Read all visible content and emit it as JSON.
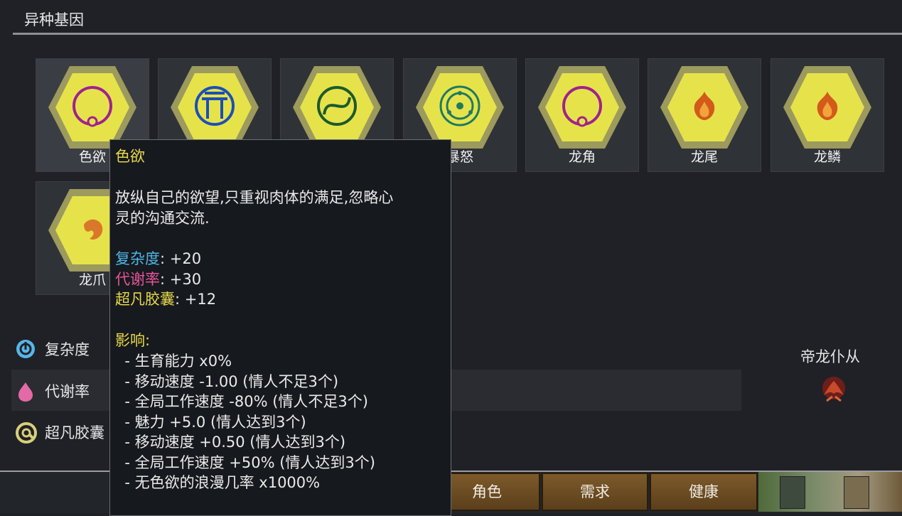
{
  "section_title": "异种基因",
  "genes": [
    {
      "label": "色欲",
      "icon": "lust-ring-icon"
    },
    {
      "label": "",
      "icon": "pi-circle-icon"
    },
    {
      "label": "",
      "icon": "swirl-circle-icon"
    },
    {
      "label": "暴怒",
      "icon": "triskele-circle-icon"
    },
    {
      "label": "龙角",
      "icon": "ring-icon"
    },
    {
      "label": "龙尾",
      "icon": "flame-icon"
    },
    {
      "label": "龙鳞",
      "icon": "flame-icon"
    },
    {
      "label": "龙爪",
      "icon": "claw-icon"
    }
  ],
  "stats": {
    "complexity": "复杂度",
    "metabolism": "代谢率",
    "archite": "超凡胶囊"
  },
  "xenotype": {
    "label": "帝龙仆从",
    "icon": "dragon-emblem-icon"
  },
  "tabs": [
    "角色",
    "需求",
    "健康"
  ],
  "tooltip": {
    "title": "色欲",
    "desc_line1": "放纵自己的欲望,只重视肉体的满足,忽略心",
    "desc_line2": "灵的沟通交流.",
    "complexity_label": "复杂度",
    "complexity_value": ": +20",
    "metabolism_label": "代谢率",
    "metabolism_value": ": +30",
    "archite_label": "超凡胶囊",
    "archite_value": ": +12",
    "effects_title": "影响:",
    "effects": [
      "  - 生育能力 x0%",
      "  - 移动速度 -1.00 (情人不足3个)",
      "  - 全局工作速度 -80% (情人不足3个)",
      "  - 魅力 +5.0 (情人达到3个)",
      "  - 移动速度 +0.50 (情人达到3个)",
      "  - 全局工作速度 +50% (情人达到3个)",
      "  - 无色欲的浪漫几率 x1000%"
    ]
  },
  "colors": {
    "hex_yellow": "#e6e34a",
    "hex_rim": "#9c9a5c",
    "tooltip_yellow": "#e8d84c",
    "complexity_cyan": "#4fb6e6",
    "metabolism_pink": "#e5559b",
    "tab_brown": "#6b4b22"
  }
}
